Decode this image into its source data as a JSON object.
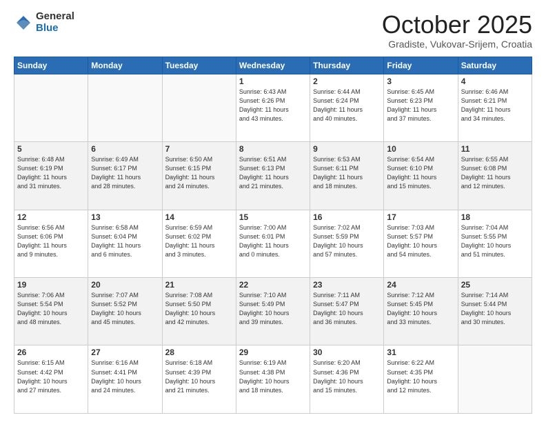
{
  "header": {
    "logo_general": "General",
    "logo_blue": "Blue",
    "month": "October 2025",
    "location": "Gradiste, Vukovar-Srijem, Croatia"
  },
  "weekdays": [
    "Sunday",
    "Monday",
    "Tuesday",
    "Wednesday",
    "Thursday",
    "Friday",
    "Saturday"
  ],
  "weeks": [
    [
      {
        "day": "",
        "info": ""
      },
      {
        "day": "",
        "info": ""
      },
      {
        "day": "",
        "info": ""
      },
      {
        "day": "1",
        "info": "Sunrise: 6:43 AM\nSunset: 6:26 PM\nDaylight: 11 hours\nand 43 minutes."
      },
      {
        "day": "2",
        "info": "Sunrise: 6:44 AM\nSunset: 6:24 PM\nDaylight: 11 hours\nand 40 minutes."
      },
      {
        "day": "3",
        "info": "Sunrise: 6:45 AM\nSunset: 6:23 PM\nDaylight: 11 hours\nand 37 minutes."
      },
      {
        "day": "4",
        "info": "Sunrise: 6:46 AM\nSunset: 6:21 PM\nDaylight: 11 hours\nand 34 minutes."
      }
    ],
    [
      {
        "day": "5",
        "info": "Sunrise: 6:48 AM\nSunset: 6:19 PM\nDaylight: 11 hours\nand 31 minutes."
      },
      {
        "day": "6",
        "info": "Sunrise: 6:49 AM\nSunset: 6:17 PM\nDaylight: 11 hours\nand 28 minutes."
      },
      {
        "day": "7",
        "info": "Sunrise: 6:50 AM\nSunset: 6:15 PM\nDaylight: 11 hours\nand 24 minutes."
      },
      {
        "day": "8",
        "info": "Sunrise: 6:51 AM\nSunset: 6:13 PM\nDaylight: 11 hours\nand 21 minutes."
      },
      {
        "day": "9",
        "info": "Sunrise: 6:53 AM\nSunset: 6:11 PM\nDaylight: 11 hours\nand 18 minutes."
      },
      {
        "day": "10",
        "info": "Sunrise: 6:54 AM\nSunset: 6:10 PM\nDaylight: 11 hours\nand 15 minutes."
      },
      {
        "day": "11",
        "info": "Sunrise: 6:55 AM\nSunset: 6:08 PM\nDaylight: 11 hours\nand 12 minutes."
      }
    ],
    [
      {
        "day": "12",
        "info": "Sunrise: 6:56 AM\nSunset: 6:06 PM\nDaylight: 11 hours\nand 9 minutes."
      },
      {
        "day": "13",
        "info": "Sunrise: 6:58 AM\nSunset: 6:04 PM\nDaylight: 11 hours\nand 6 minutes."
      },
      {
        "day": "14",
        "info": "Sunrise: 6:59 AM\nSunset: 6:02 PM\nDaylight: 11 hours\nand 3 minutes."
      },
      {
        "day": "15",
        "info": "Sunrise: 7:00 AM\nSunset: 6:01 PM\nDaylight: 11 hours\nand 0 minutes."
      },
      {
        "day": "16",
        "info": "Sunrise: 7:02 AM\nSunset: 5:59 PM\nDaylight: 10 hours\nand 57 minutes."
      },
      {
        "day": "17",
        "info": "Sunrise: 7:03 AM\nSunset: 5:57 PM\nDaylight: 10 hours\nand 54 minutes."
      },
      {
        "day": "18",
        "info": "Sunrise: 7:04 AM\nSunset: 5:55 PM\nDaylight: 10 hours\nand 51 minutes."
      }
    ],
    [
      {
        "day": "19",
        "info": "Sunrise: 7:06 AM\nSunset: 5:54 PM\nDaylight: 10 hours\nand 48 minutes."
      },
      {
        "day": "20",
        "info": "Sunrise: 7:07 AM\nSunset: 5:52 PM\nDaylight: 10 hours\nand 45 minutes."
      },
      {
        "day": "21",
        "info": "Sunrise: 7:08 AM\nSunset: 5:50 PM\nDaylight: 10 hours\nand 42 minutes."
      },
      {
        "day": "22",
        "info": "Sunrise: 7:10 AM\nSunset: 5:49 PM\nDaylight: 10 hours\nand 39 minutes."
      },
      {
        "day": "23",
        "info": "Sunrise: 7:11 AM\nSunset: 5:47 PM\nDaylight: 10 hours\nand 36 minutes."
      },
      {
        "day": "24",
        "info": "Sunrise: 7:12 AM\nSunset: 5:45 PM\nDaylight: 10 hours\nand 33 minutes."
      },
      {
        "day": "25",
        "info": "Sunrise: 7:14 AM\nSunset: 5:44 PM\nDaylight: 10 hours\nand 30 minutes."
      }
    ],
    [
      {
        "day": "26",
        "info": "Sunrise: 6:15 AM\nSunset: 4:42 PM\nDaylight: 10 hours\nand 27 minutes."
      },
      {
        "day": "27",
        "info": "Sunrise: 6:16 AM\nSunset: 4:41 PM\nDaylight: 10 hours\nand 24 minutes."
      },
      {
        "day": "28",
        "info": "Sunrise: 6:18 AM\nSunset: 4:39 PM\nDaylight: 10 hours\nand 21 minutes."
      },
      {
        "day": "29",
        "info": "Sunrise: 6:19 AM\nSunset: 4:38 PM\nDaylight: 10 hours\nand 18 minutes."
      },
      {
        "day": "30",
        "info": "Sunrise: 6:20 AM\nSunset: 4:36 PM\nDaylight: 10 hours\nand 15 minutes."
      },
      {
        "day": "31",
        "info": "Sunrise: 6:22 AM\nSunset: 4:35 PM\nDaylight: 10 hours\nand 12 minutes."
      },
      {
        "day": "",
        "info": ""
      }
    ]
  ]
}
